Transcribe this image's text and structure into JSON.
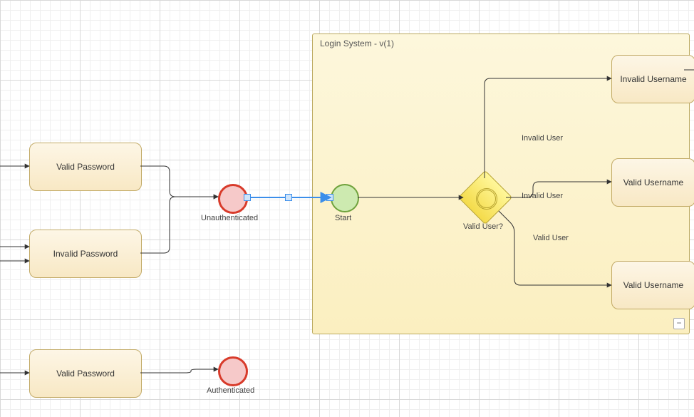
{
  "pool": {
    "title": "Login System - v(1)"
  },
  "tasks": {
    "valid_password_1": "Valid Password",
    "invalid_password": "Invalid Password",
    "valid_password_2": "Valid Password",
    "invalid_username": "Invalid Username",
    "valid_username_1": "Valid Username",
    "valid_username_2": "Valid Username"
  },
  "events": {
    "unauthenticated": "Unauthenticated",
    "start": "Start",
    "authenticated": "Authenticated"
  },
  "gateway": {
    "label": "Valid User?"
  },
  "flows": {
    "invalid_user_top": "Invalid User",
    "invalid_user_mid": "Invalid User",
    "valid_user": "Valid User"
  },
  "pool_collapse_glyph": "−"
}
